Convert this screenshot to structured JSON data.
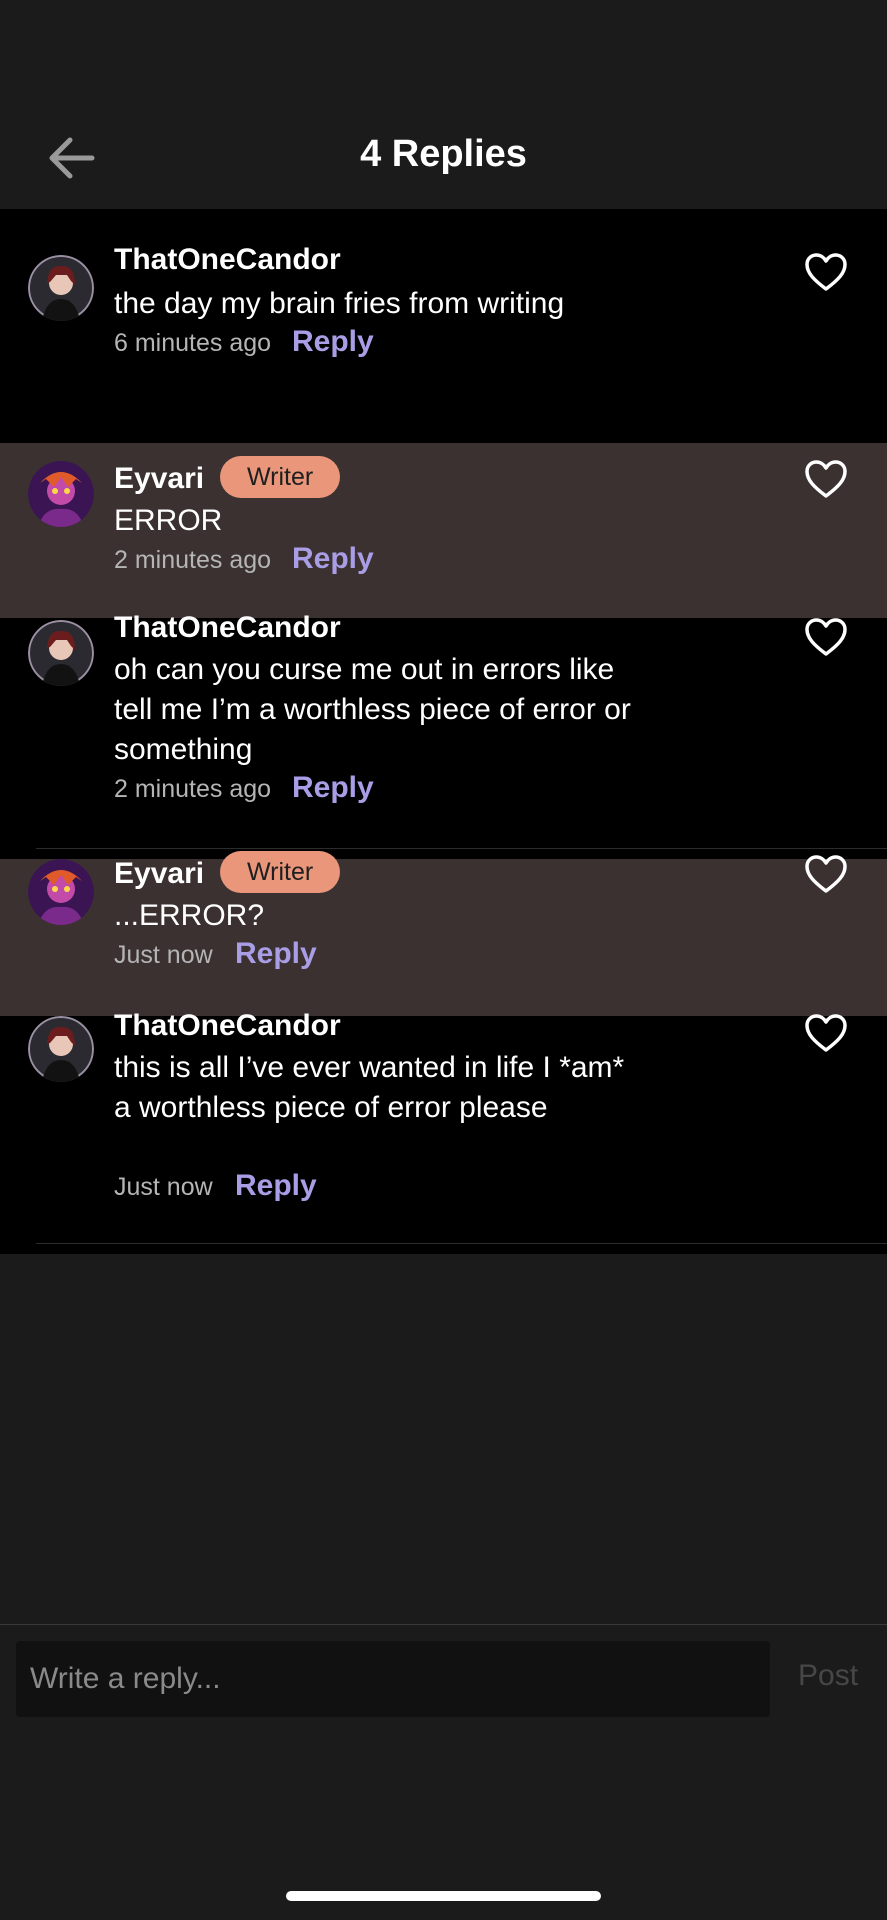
{
  "header": {
    "title": "4 Replies",
    "back_icon": "arrow-left-icon"
  },
  "comments": [
    {
      "author": "ThatOneCandor",
      "badge": "",
      "text": "the day my brain fries from writing",
      "time": "6 minutes ago",
      "reply_label": "Reply",
      "avatar": "avatar-candor",
      "heart_icon": "heart-outline-icon"
    },
    {
      "author": "Eyvari",
      "badge": "Writer",
      "text": "ERROR",
      "time": "2 minutes ago",
      "reply_label": "Reply",
      "avatar": "avatar-eyvari",
      "heart_icon": "heart-outline-icon"
    },
    {
      "author": "ThatOneCandor",
      "badge": "",
      "text": "oh can you curse me out in errors like tell me I’m a worthless piece of error or something",
      "time": "2 minutes ago",
      "reply_label": "Reply",
      "avatar": "avatar-candor",
      "heart_icon": "heart-outline-icon"
    },
    {
      "author": "Eyvari",
      "badge": "Writer",
      "text": "...ERROR?",
      "time": "Just now",
      "reply_label": "Reply",
      "avatar": "avatar-eyvari",
      "heart_icon": "heart-outline-icon"
    },
    {
      "author": "ThatOneCandor",
      "badge": "",
      "text": "this is all I’ve ever wanted in life I *am* a worthless piece of error please",
      "time": "Just now",
      "reply_label": "Reply",
      "avatar": "avatar-candor",
      "heart_icon": "heart-outline-icon"
    }
  ],
  "composer": {
    "placeholder": "Write a reply...",
    "post_label": "Post"
  },
  "colors": {
    "background": "#1b1b1b",
    "list_background": "#000000",
    "highlight": "#3a3130",
    "badge": "#e9967a",
    "reply_link": "#a99de6",
    "post_disabled": "#474747"
  }
}
